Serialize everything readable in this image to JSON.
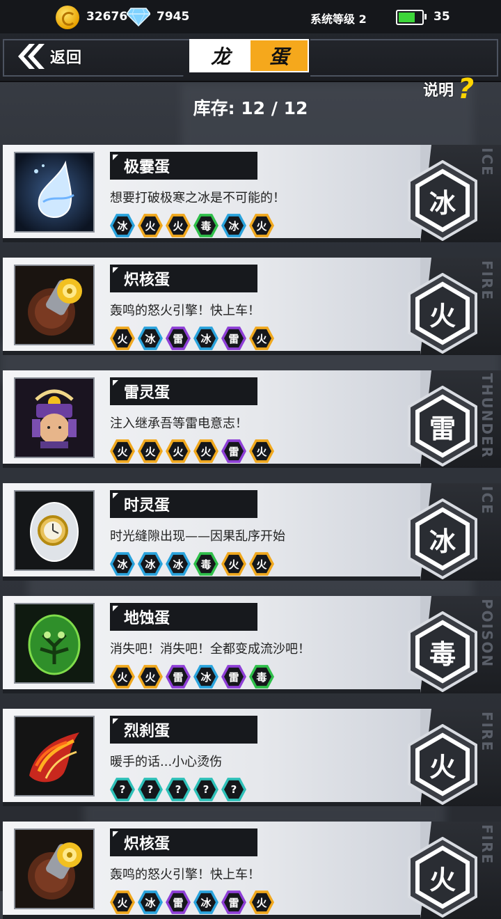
{
  "status": {
    "gold": "32676",
    "gems": "7945",
    "system_level": "系统等级 2",
    "energy": "35",
    "energy_fill": 0.72
  },
  "nav": {
    "back_label": "返回",
    "title_left": "龙",
    "title_right": "蛋",
    "help_label": "说明",
    "help_mark": "?"
  },
  "inventory": "库存: 12 / 12",
  "colors": {
    "ice": "#2aa3dc",
    "fire": "#f0a81e",
    "thunder": "#8e3fd6",
    "poison": "#2fbf4a",
    "unknown": "#2ec0b8",
    "accent": "#f5a81c"
  },
  "eggs": [
    {
      "name": "极霎蛋",
      "desc": "想要打破极寒之冰是不可能的！",
      "element": "冰",
      "element_en": "ICE",
      "icon": "ice-drop-egg-icon",
      "skills": [
        {
          "t": "冰",
          "k": "ice"
        },
        {
          "t": "火",
          "k": "fire"
        },
        {
          "t": "火",
          "k": "fire"
        },
        {
          "t": "毒",
          "k": "poison"
        },
        {
          "t": "冰",
          "k": "ice"
        },
        {
          "t": "火",
          "k": "fire"
        }
      ]
    },
    {
      "name": "炽核蛋",
      "desc": "轰鸣的怒火引擎！快上车！",
      "element": "火",
      "element_en": "FIRE",
      "icon": "engine-egg-icon",
      "skills": [
        {
          "t": "火",
          "k": "fire"
        },
        {
          "t": "冰",
          "k": "ice"
        },
        {
          "t": "雷",
          "k": "thunder"
        },
        {
          "t": "冰",
          "k": "ice"
        },
        {
          "t": "雷",
          "k": "thunder"
        },
        {
          "t": "火",
          "k": "fire"
        }
      ]
    },
    {
      "name": "雷灵蛋",
      "desc": "注入继承吾等雷电意志！",
      "element": "雷",
      "element_en": "THUNDER",
      "icon": "samurai-egg-icon",
      "skills": [
        {
          "t": "火",
          "k": "fire"
        },
        {
          "t": "火",
          "k": "fire"
        },
        {
          "t": "火",
          "k": "fire"
        },
        {
          "t": "火",
          "k": "fire"
        },
        {
          "t": "雷",
          "k": "thunder"
        },
        {
          "t": "火",
          "k": "fire"
        }
      ]
    },
    {
      "name": "时灵蛋",
      "desc": "时光缝隙出现——因果乱序开始",
      "element": "冰",
      "element_en": "ICE",
      "icon": "clock-egg-icon",
      "skills": [
        {
          "t": "冰",
          "k": "ice"
        },
        {
          "t": "冰",
          "k": "ice"
        },
        {
          "t": "冰",
          "k": "ice"
        },
        {
          "t": "毒",
          "k": "poison"
        },
        {
          "t": "火",
          "k": "fire"
        },
        {
          "t": "火",
          "k": "fire"
        }
      ]
    },
    {
      "name": "地蚀蛋",
      "desc": "消失吧！消失吧！全都变成流沙吧！",
      "element": "毒",
      "element_en": "POISON",
      "icon": "tree-egg-icon",
      "skills": [
        {
          "t": "火",
          "k": "fire"
        },
        {
          "t": "火",
          "k": "fire"
        },
        {
          "t": "雷",
          "k": "thunder"
        },
        {
          "t": "冰",
          "k": "ice"
        },
        {
          "t": "雷",
          "k": "thunder"
        },
        {
          "t": "毒",
          "k": "poison"
        }
      ]
    },
    {
      "name": "烈刹蛋",
      "desc": "暖手的话...小心烫伤",
      "element": "火",
      "element_en": "FIRE",
      "icon": "flame-claw-egg-icon",
      "skills": [
        {
          "t": "?",
          "k": "unknown"
        },
        {
          "t": "?",
          "k": "unknown"
        },
        {
          "t": "?",
          "k": "unknown"
        },
        {
          "t": "?",
          "k": "unknown"
        },
        {
          "t": "?",
          "k": "unknown"
        }
      ]
    },
    {
      "name": "炽核蛋",
      "desc": "轰鸣的怒火引擎！快上车！",
      "element": "火",
      "element_en": "FIRE",
      "icon": "engine-egg-icon",
      "skills": [
        {
          "t": "火",
          "k": "fire"
        },
        {
          "t": "冰",
          "k": "ice"
        },
        {
          "t": "雷",
          "k": "thunder"
        },
        {
          "t": "冰",
          "k": "ice"
        },
        {
          "t": "雷",
          "k": "thunder"
        },
        {
          "t": "火",
          "k": "fire"
        }
      ]
    }
  ]
}
